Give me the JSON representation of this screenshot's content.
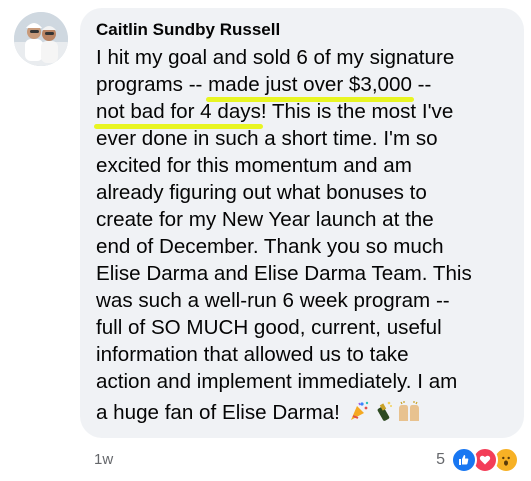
{
  "comment": {
    "author": "Caitlin Sundby Russell",
    "lines": [
      "I hit my goal and sold 6 of my signature",
      "programs -- ",
      "made just over $3,000",
      " --",
      "not bad for 4 days",
      "! This is the most I've",
      "ever done in such a short time. I'm so",
      "excited for this momentum and am",
      "already figuring out what bonuses to",
      "create for my New Year launch at the",
      "end of December. Thank you so much",
      "Elise Darma and Elise Darma Team. This",
      "was such a well-run 6 week program --",
      "full of SO MUCH good, current, useful",
      "information that allowed us to take",
      "action and implement immediately. I am",
      "a huge fan of Elise Darma! "
    ],
    "emojis": [
      "party-popper-icon",
      "champagne-icon",
      "raising-hands-icon"
    ],
    "highlight_color": "#e8f522"
  },
  "footer": {
    "timestamp": "1w",
    "reaction_count": "5",
    "reactions": [
      "like-icon",
      "love-icon",
      "wow-icon"
    ]
  },
  "colors": {
    "bubble": "#f0f2f5",
    "text": "#050505",
    "muted": "#65676b",
    "like": "#1877f2",
    "love": "#f33e58",
    "wow": "#f7b125"
  }
}
